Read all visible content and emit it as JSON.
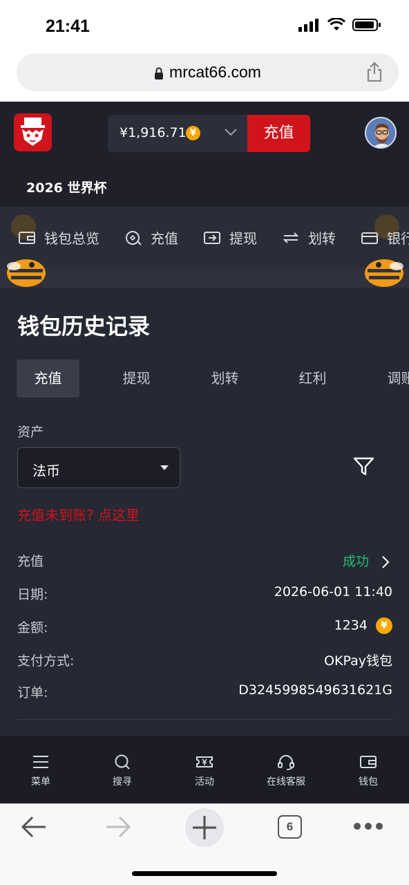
{
  "status_bar": {
    "time": "21:41"
  },
  "browser": {
    "url": "mrcat66.com",
    "tab_count": "6"
  },
  "header": {
    "balance": "¥1,916.71",
    "coin_symbol": "¥",
    "deposit_label": "充值",
    "subtitle": "2026 世界杯"
  },
  "wallet_nav": {
    "items": [
      {
        "label": "钱包总览",
        "icon": "wallet-icon"
      },
      {
        "label": "充值",
        "icon": "deposit-icon"
      },
      {
        "label": "提现",
        "icon": "withdraw-icon"
      },
      {
        "label": "划转",
        "icon": "transfer-icon"
      },
      {
        "label": "银行卡",
        "icon": "card-icon"
      }
    ]
  },
  "history": {
    "title": "钱包历史记录",
    "tabs": [
      "充值",
      "提现",
      "划转",
      "红利",
      "调账"
    ],
    "active_tab": "充值",
    "asset_label": "资产",
    "asset_value": "法币",
    "help_link": "充值未到账? 点这里"
  },
  "record": {
    "type": "充值",
    "status": "成功",
    "date_label": "日期:",
    "date": "2026-06-01 11:40",
    "amount_label": "金额:",
    "amount": "1234",
    "method_label": "支付方式:",
    "method": "OKPay钱包",
    "order_label": "订单:",
    "order": "D3245998549631621G"
  },
  "bottom_nav": {
    "items": [
      {
        "label": "菜单",
        "icon": "menu-icon"
      },
      {
        "label": "搜寻",
        "icon": "search-icon"
      },
      {
        "label": "活动",
        "icon": "ticket-icon"
      },
      {
        "label": "在线客服",
        "icon": "headset-icon"
      },
      {
        "label": "钱包",
        "icon": "wallet-icon"
      }
    ]
  },
  "colors": {
    "brand_red": "#d0141b",
    "success_green": "#1fbf75",
    "page_bg": "#262834",
    "coin_gold": "#f5a800"
  }
}
